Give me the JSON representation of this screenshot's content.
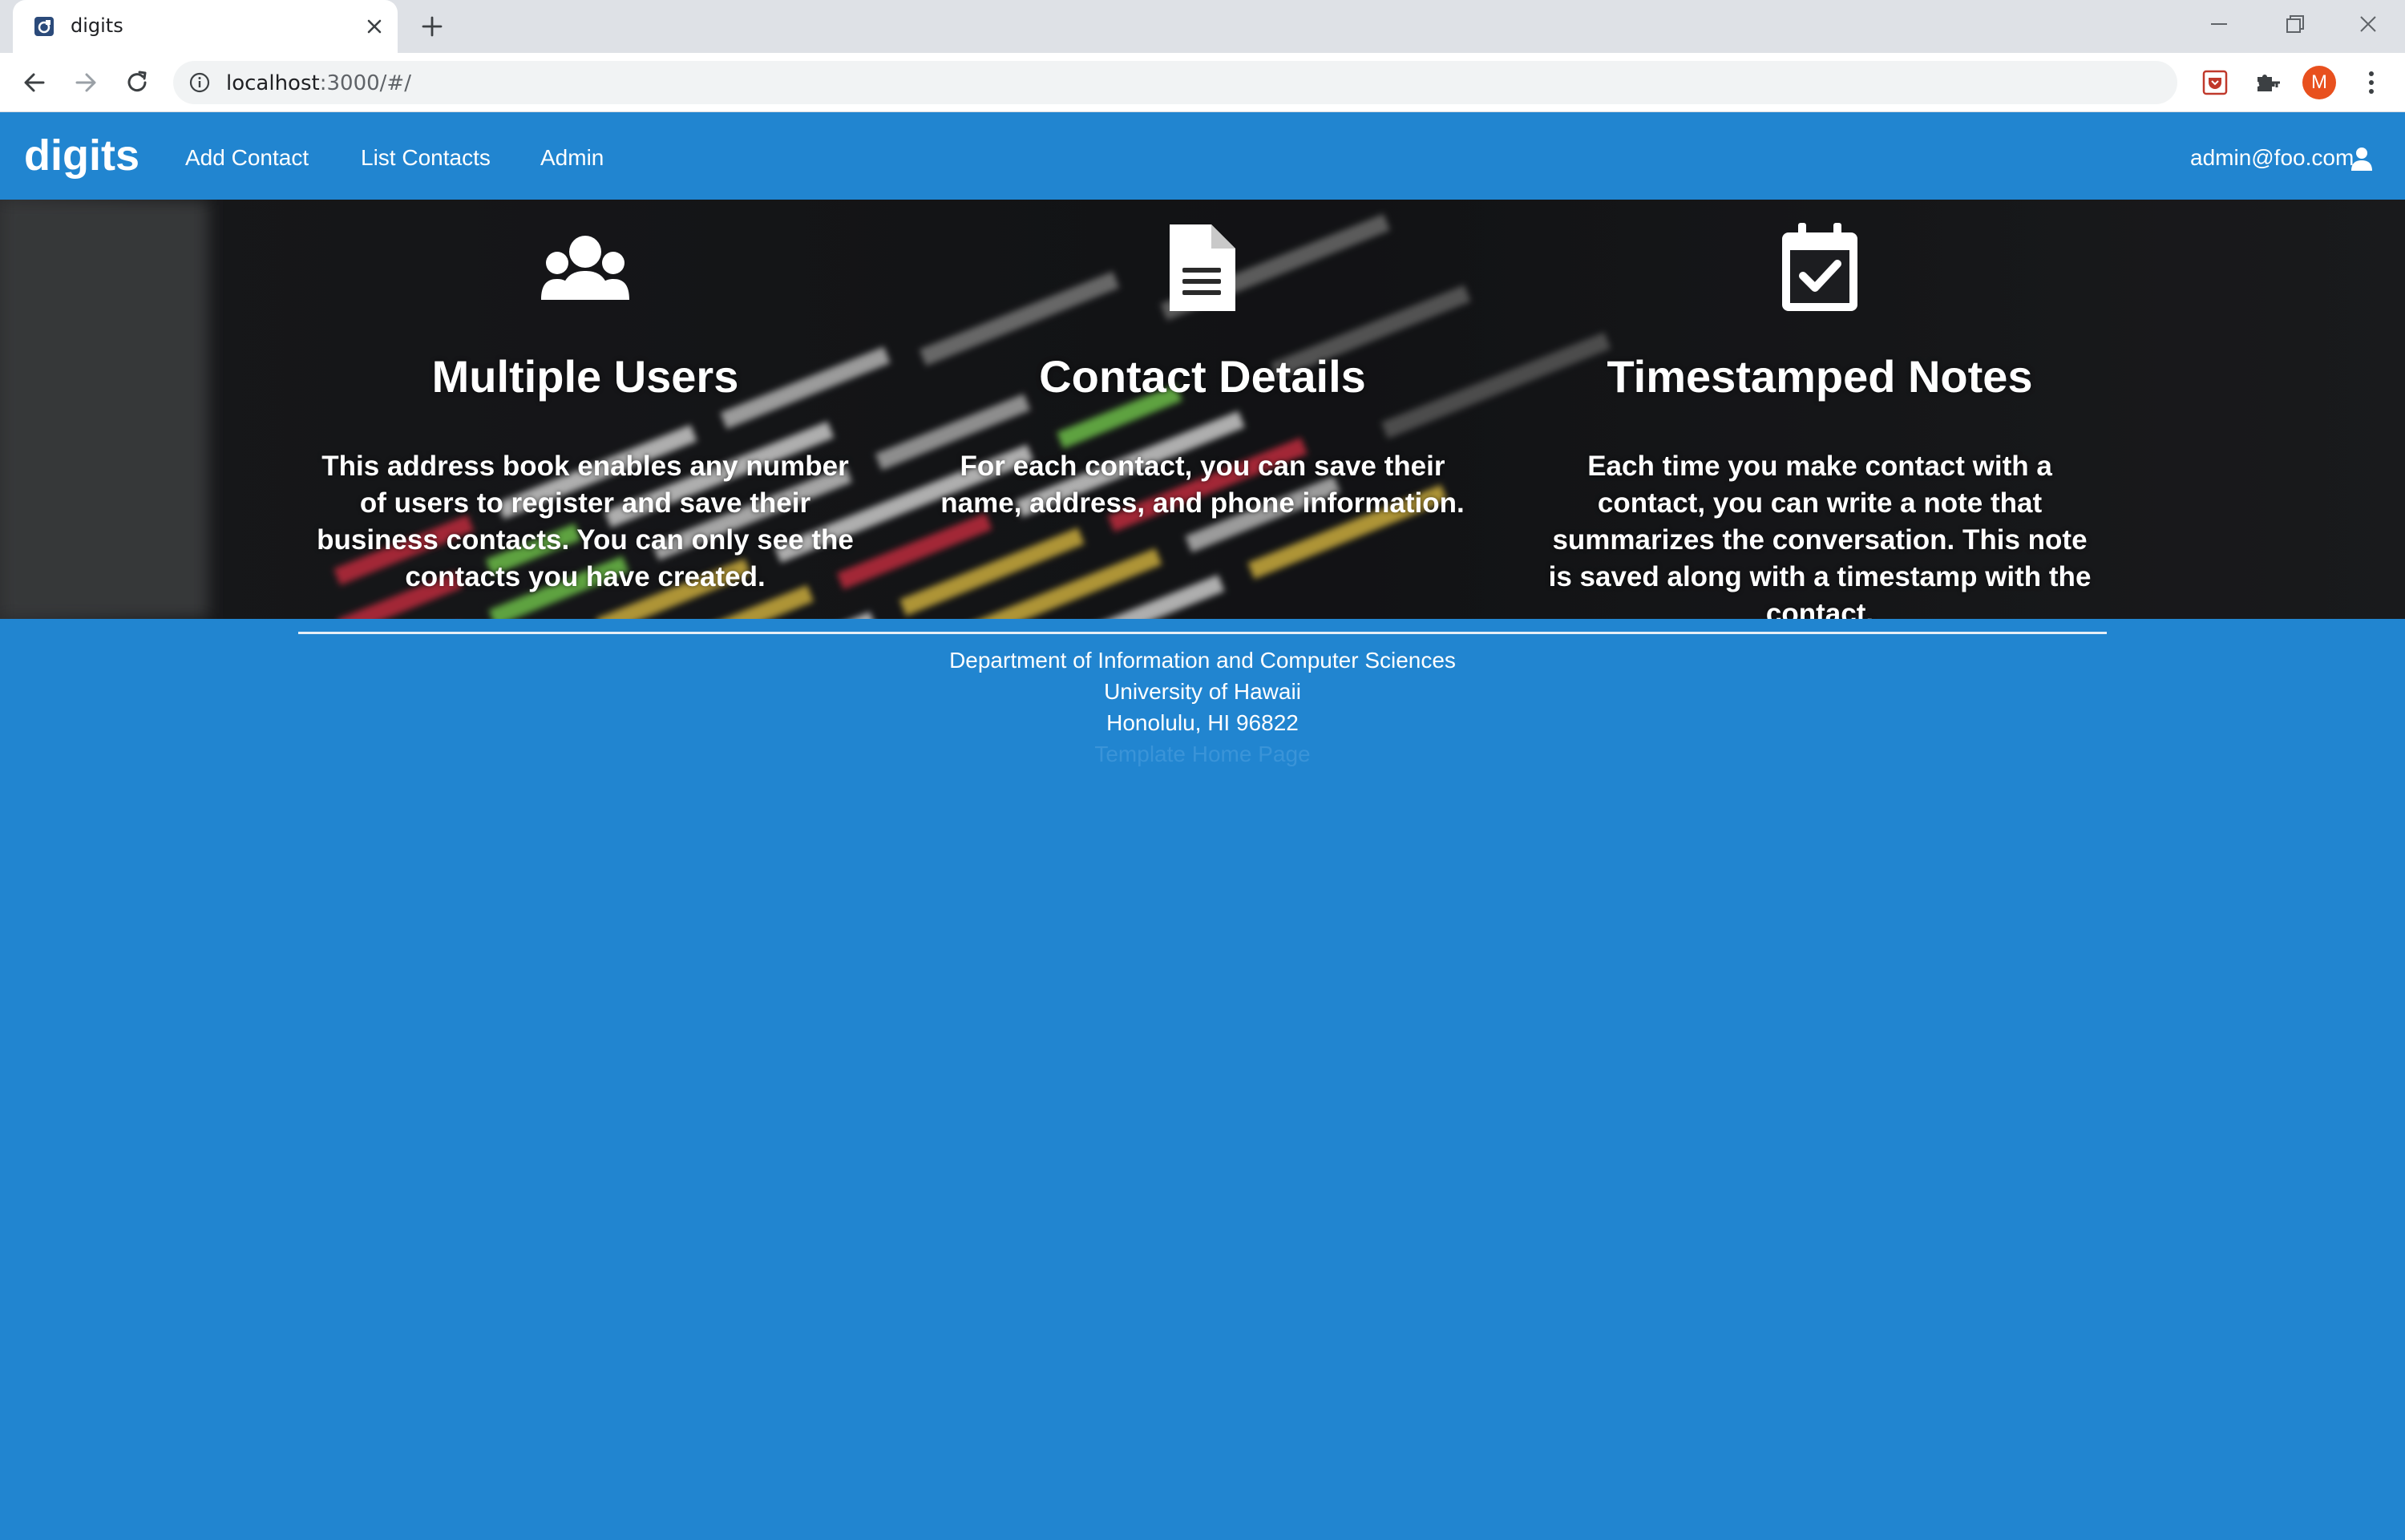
{
  "browser": {
    "tab_title": "digits",
    "url_host": "localhost",
    "url_rest": ":3000/#/",
    "profile_initial": "M"
  },
  "navbar": {
    "brand": "digits",
    "links": [
      "Add Contact",
      "List Contacts",
      "Admin"
    ],
    "user": "admin@foo.com",
    "color": "#2185d0"
  },
  "features": [
    {
      "icon": "users-icon",
      "title": "Multiple Users",
      "text": "This address book enables any number of users to register and save their business contacts. You can only see the contacts you have created."
    },
    {
      "icon": "file-text-icon",
      "title": "Contact Details",
      "text": "For each contact, you can save their name, address, and phone information."
    },
    {
      "icon": "calendar-check-icon",
      "title": "Timestamped Notes",
      "text": "Each time you make contact with a contact, you can write a note that summarizes the conversation. This note is saved along with a timestamp with the contact."
    }
  ],
  "footer": {
    "lines": [
      "Department of Information and Computer Sciences",
      "University of Hawaii",
      "Honolulu, HI 96822",
      "Template Home Page"
    ]
  }
}
